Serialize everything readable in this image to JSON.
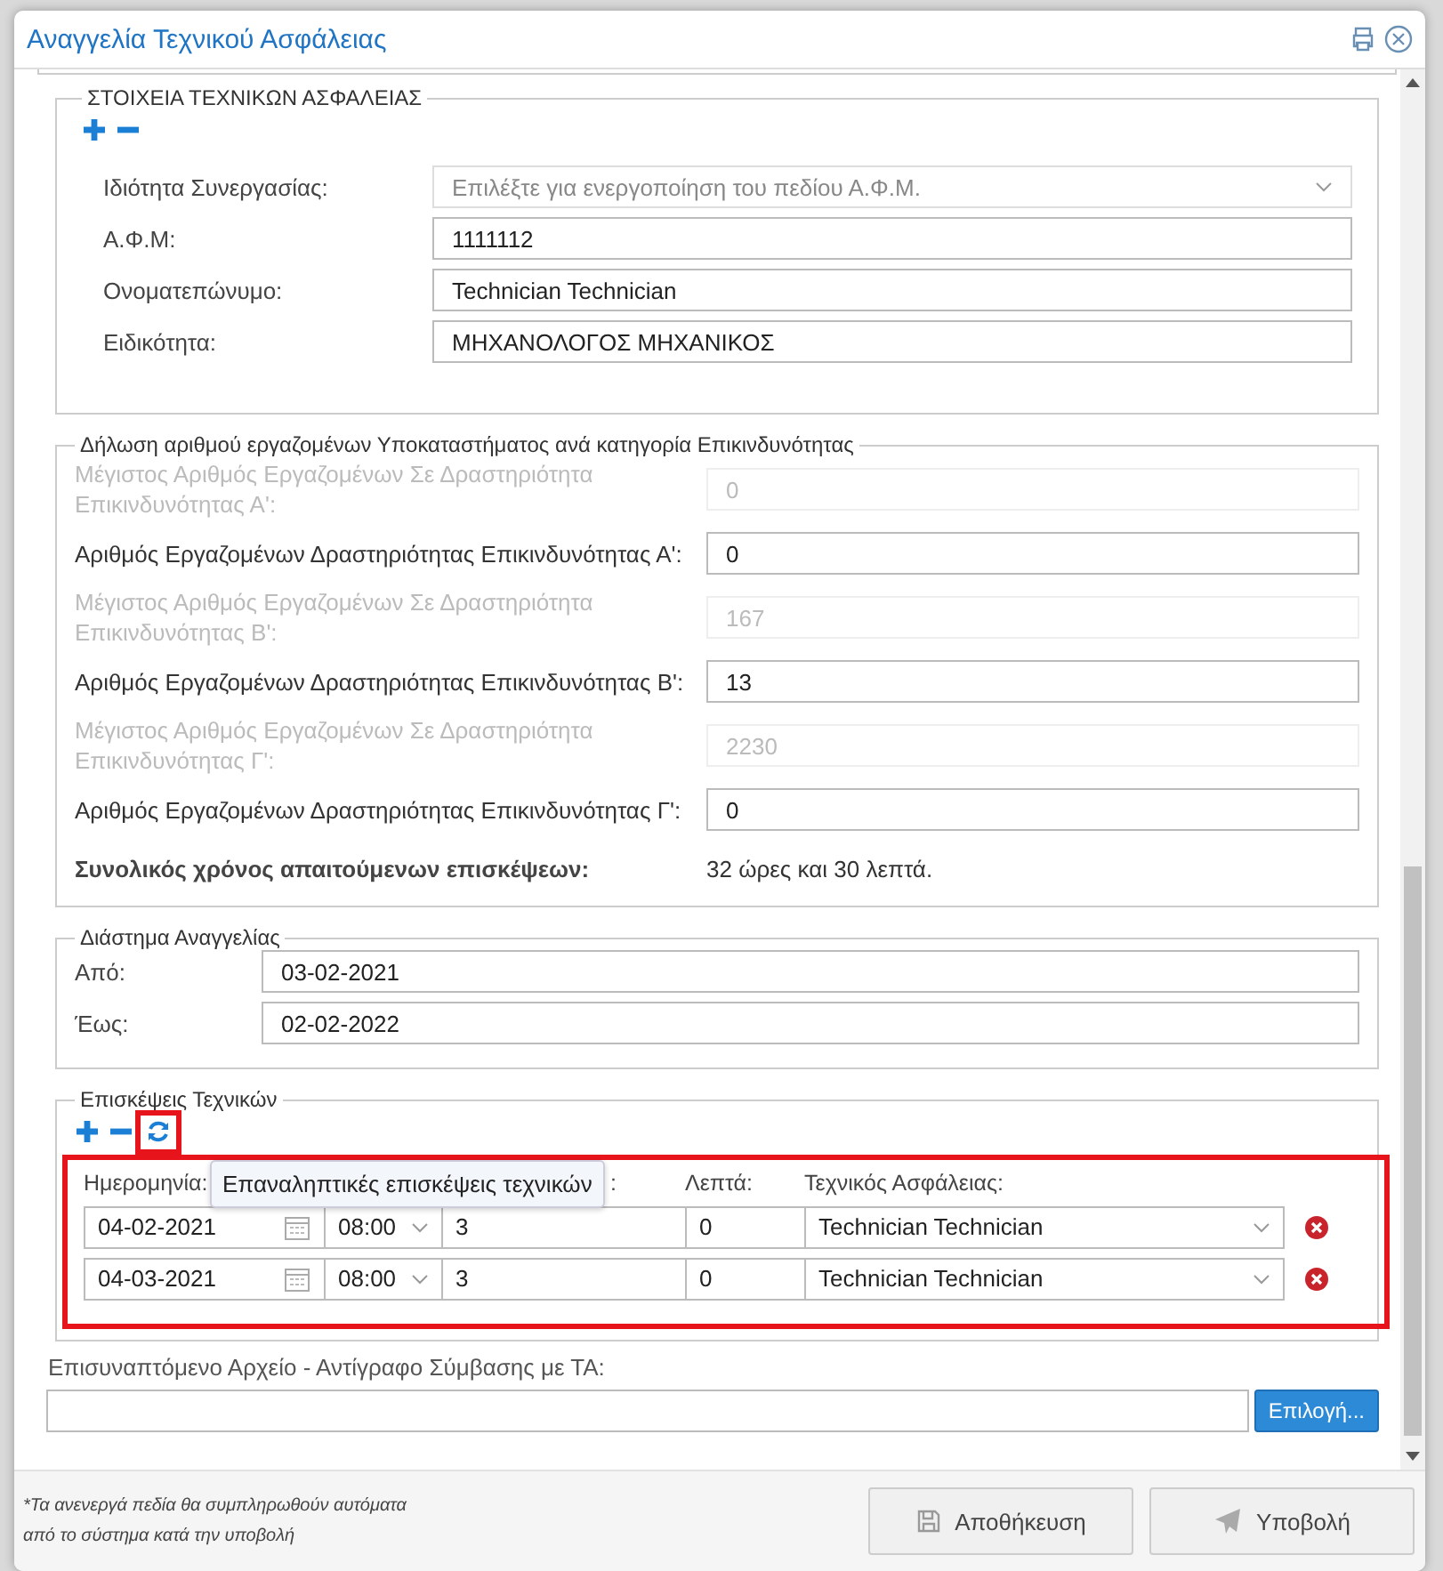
{
  "dialog": {
    "title": "Αναγγελία Τεχνικού Ασφάλειας"
  },
  "technician_section": {
    "legend": "ΣΤΟΙΧΕΙΑ ΤΕΧΝΙΚΩΝ ΑΣΦΑΛΕΙΑΣ",
    "fields": [
      {
        "kind": "select",
        "label": "Ιδιότητα Συνεργασίας:",
        "placeholder": "Επιλέξτε για ενεργοποίηση του πεδίου Α.Φ.Μ."
      },
      {
        "kind": "text",
        "label": "Α.Φ.Μ:",
        "value": "1111112"
      },
      {
        "kind": "text",
        "label": "Ονοματεπώνυμο:",
        "value": "Technician Technician"
      },
      {
        "kind": "text",
        "label": "Ειδικότητα:",
        "value": "ΜΗΧΑΝΟΛΟΓΟΣ ΜΗΧΑΝΙΚΟΣ"
      }
    ]
  },
  "employees_section": {
    "legend": "Δήλωση αριθμού εργαζομένων Υποκαταστήματος ανά κατηγορία Επικινδυνότητας",
    "fields": [
      {
        "label": "Μέγιστος Αριθμός Εργαζομένων Σε Δραστηριότητα Επικινδυνότητας Α':",
        "value": "0",
        "disabled": true
      },
      {
        "label": "Αριθμός Εργαζομένων Δραστηριότητας Επικινδυνότητας Α':",
        "value": "0",
        "disabled": false
      },
      {
        "label": "Μέγιστος Αριθμός Εργαζομένων Σε Δραστηριότητα Επικινδυνότητας Β':",
        "value": "167",
        "disabled": true
      },
      {
        "label": "Αριθμός Εργαζομένων Δραστηριότητας Επικινδυνότητας Β':",
        "value": "13",
        "disabled": false
      },
      {
        "label": "Μέγιστος Αριθμός Εργαζομένων Σε Δραστηριότητα Επικινδυνότητας Γ':",
        "value": "2230",
        "disabled": true
      },
      {
        "label": "Αριθμός Εργαζομένων Δραστηριότητας Επικινδυνότητας Γ':",
        "value": "0",
        "disabled": false
      }
    ],
    "total_label": "Συνολικός χρόνος απαιτούμενων επισκέψεων:",
    "total_value": "32 ώρες και 30 λεπτά."
  },
  "period_section": {
    "legend": "Διάστημα Αναγγελίας",
    "fields": [
      {
        "label": "Από:",
        "value": "03-02-2021"
      },
      {
        "label": "Έως:",
        "value": "02-02-2022"
      }
    ]
  },
  "visits_section": {
    "legend": "Επισκέψεις Τεχνικών",
    "columns": [
      "Ημερομηνία:",
      "",
      ":",
      "Λεπτά:",
      "Τεχνικός Ασφάλειας:"
    ],
    "rows": [
      {
        "date": "04-02-2021",
        "time": "08:00",
        "hours": "3",
        "minutes": "0",
        "technician": "Technician Technician"
      },
      {
        "date": "04-03-2021",
        "time": "08:00",
        "hours": "3",
        "minutes": "0",
        "technician": "Technician Technician"
      }
    ],
    "tooltip": "Επαναληπτικές επισκέψεις τεχνικών"
  },
  "attachment": {
    "label": "Επισυναπτόμενο Αρχείο - Αντίγραφο Σύμβασης με ΤΑ:",
    "button": "Επιλογή..."
  },
  "footer": {
    "note_lines": [
      "*Τα ανενεργά πεδία θα συμπληρωθούν αυτόματα",
      "από το σύστημα κατά την υποβολή"
    ],
    "save_button": "Αποθήκευση",
    "submit_button": "Υποβολή"
  }
}
